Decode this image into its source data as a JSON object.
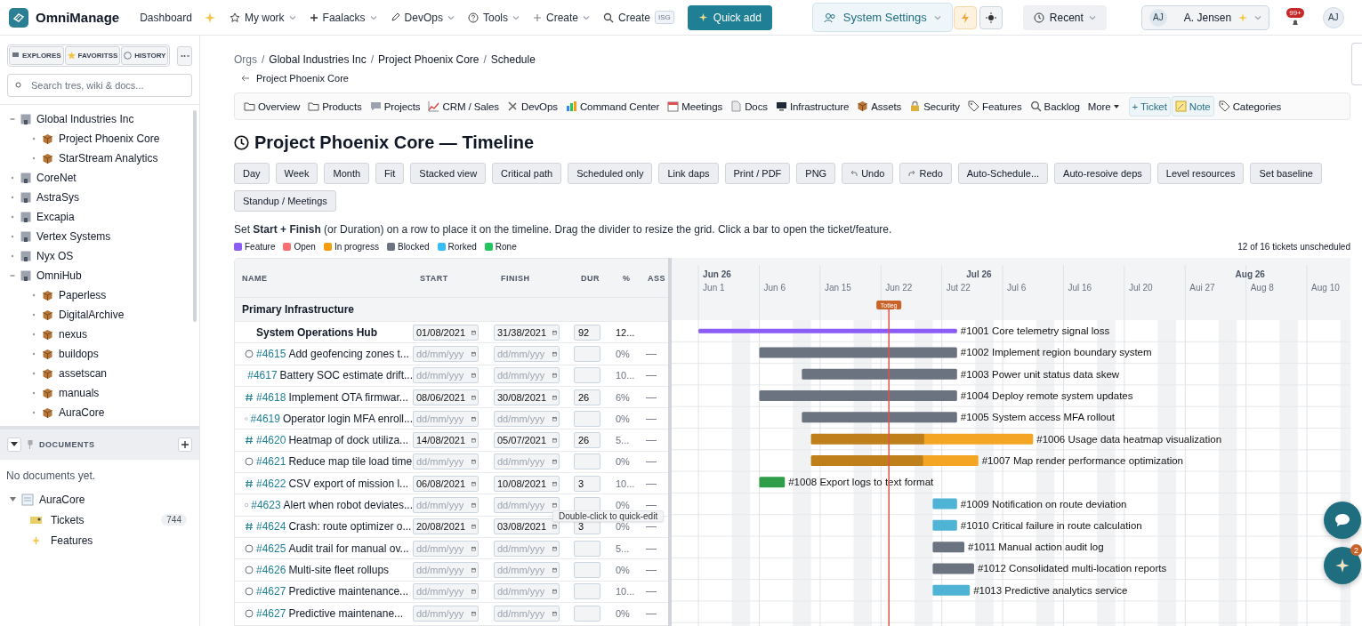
{
  "topbar": {
    "brand": "OmniManage",
    "nav": [
      {
        "label": "Dashboard",
        "kind": "dashboard",
        "caret": false
      },
      {
        "label": "My work",
        "kind": "star",
        "caret": true
      },
      {
        "label": "Faalacks",
        "kind": "plus",
        "caret": true
      },
      {
        "label": "DevOps",
        "kind": "pencil",
        "caret": true
      },
      {
        "label": "Tools",
        "kind": "help",
        "caret": true
      },
      {
        "label": "Create",
        "kind": "plus-light",
        "caret": true
      },
      {
        "label": "Create",
        "kind": "search",
        "caret": false,
        "shortcut": "ISG"
      }
    ],
    "quick_add": "Quick add",
    "settings": "System Settings",
    "recent": "Recent",
    "user": {
      "initials": "AJ",
      "name": "A. Jensen"
    },
    "notifications": "99+",
    "avatar": "AJ"
  },
  "sidebar": {
    "tabs": [
      "EXPLORES",
      "FAVORITSS",
      "HISTORY"
    ],
    "search": {
      "placeholder": "Search tres, wiki & docs..."
    },
    "tree": [
      {
        "label": "Global Industries Inc",
        "expanded": true,
        "children": [
          {
            "label": "Project Phoenix Core"
          },
          {
            "label": "StarStream Analytics"
          }
        ]
      },
      {
        "label": "CoreNet",
        "expanded": false
      },
      {
        "label": "AstraSys",
        "expanded": false
      },
      {
        "label": "Excapia",
        "expanded": false
      },
      {
        "label": "Vertex Systems",
        "expanded": false
      },
      {
        "label": "Nyx OS",
        "expanded": false
      },
      {
        "label": "OmniHub",
        "expanded": true,
        "children": [
          {
            "label": "Paperless"
          },
          {
            "label": "DigitalArchive"
          },
          {
            "label": "nexus"
          },
          {
            "label": "buildops"
          },
          {
            "label": "assetscan"
          },
          {
            "label": "manuals"
          },
          {
            "label": "AuraCore"
          }
        ]
      }
    ],
    "documents": {
      "title": "DOCUMENTS",
      "empty": "No documents yet.",
      "tree": {
        "label": "AuraCore",
        "expanded": true,
        "children": [
          {
            "label": "Tickets",
            "kind": "tickets",
            "count": "744"
          },
          {
            "label": "Features",
            "kind": "features"
          }
        ]
      }
    }
  },
  "breadcrumb": [
    {
      "label": "Orgs"
    },
    {
      "separator": "/",
      "label": "Global Industries Inc"
    },
    {
      "separator": "/",
      "label": "Project Phoenix Core"
    },
    {
      "separator": "/",
      "label": "Schedule"
    }
  ],
  "back_link": "Project Phoenix Core",
  "tabs": [
    {
      "label": "Overview",
      "kind": "tab"
    },
    {
      "label": "Products",
      "kind": "tab"
    },
    {
      "label": "Projects",
      "kind": "tab"
    },
    {
      "label": "CRM / Sales",
      "kind": "tab"
    },
    {
      "label": "DevOps",
      "kind": "tab"
    },
    {
      "label": "Command Center",
      "kind": "tab"
    },
    {
      "label": "Meetings",
      "kind": "tab"
    },
    {
      "label": "Docs",
      "kind": "tab"
    },
    {
      "label": "Infrastructure",
      "kind": "tab"
    },
    {
      "label": "Assets",
      "kind": "tab"
    },
    {
      "label": "Security",
      "kind": "tab"
    },
    {
      "label": "Features",
      "kind": "tab"
    },
    {
      "label": "Backlog",
      "kind": "tab"
    },
    {
      "label": "More",
      "kind": "menu"
    },
    {
      "label": "+ Ticket",
      "kind": "action"
    },
    {
      "label": "Note",
      "kind": "action"
    },
    {
      "label": "Categories",
      "kind": "tab"
    }
  ],
  "title": "Project Phoenix Core — Timeline",
  "toolbar": [
    {
      "label": "Day",
      "kind": "plain"
    },
    {
      "label": "Week",
      "kind": "plain"
    },
    {
      "label": "Month",
      "kind": "plain"
    },
    {
      "label": "Fit",
      "kind": "plain"
    },
    {
      "label": "Stacked view",
      "kind": "plain"
    },
    {
      "label": "Critical path",
      "kind": "plain"
    },
    {
      "label": "Scheduled only",
      "kind": "plain"
    },
    {
      "label": "Link daps",
      "kind": "plain"
    },
    {
      "label": "Print / PDF",
      "kind": "plain"
    },
    {
      "label": "PNG",
      "kind": "plain"
    },
    {
      "label": "Undo",
      "kind": "undo"
    },
    {
      "label": "Redo",
      "kind": "redo"
    },
    {
      "label": "Auto-Schedule...",
      "kind": "plain"
    },
    {
      "label": "Auto-resoive deps",
      "kind": "plain"
    },
    {
      "label": "Level resources",
      "kind": "plain"
    },
    {
      "label": "Set baseline",
      "kind": "plain"
    },
    {
      "label": "Standup / Meetings",
      "kind": "plain"
    }
  ],
  "hint": "Set **Start + Finish** (or Duration) on a row to place it on the timeline. Drag the divider to resize the grid. Click a bar to open the ticket/feature.",
  "legend": [
    {
      "label": "Feature",
      "color": "#8b5cf6"
    },
    {
      "label": "Open",
      "color": "#f87171"
    },
    {
      "label": "In progress",
      "color": "#f59e0b"
    },
    {
      "label": "Blocked",
      "color": "#6b7280"
    },
    {
      "label": "Rorked",
      "color": "#38bdf8"
    },
    {
      "label": "Rone",
      "color": "#22c55e"
    }
  ],
  "unscheduled": "12 of 16 tickets unscheduled",
  "table": {
    "columns": [
      "NAME",
      "START",
      "FINISH",
      "DUR",
      "%",
      "ASS"
    ],
    "group": "Primary Infrastructure",
    "rows": [
      {
        "kind": "parent",
        "title": "System Operations Hub",
        "start": "01/08/2021",
        "finish": "31/38/2021",
        "dur": "92",
        "pct": "12..."
      },
      {
        "kind": "open",
        "id": "#4615",
        "title": "Add geofencing zones t...",
        "start_placeholder": "dd/mm/yyy",
        "finish_placeholder": "dd/mm/yyy",
        "pct": "0%",
        "assignee": "—"
      },
      {
        "kind": "open",
        "id": "#4617",
        "title": "Battery SOC estimate drift...",
        "start_placeholder": "dd/mm/yyy",
        "finish_placeholder": "dd/mm/yyy",
        "pct": "10...",
        "assignee": "—"
      },
      {
        "kind": "feature",
        "id": "#4618",
        "title": "Implement OTA firmwar...",
        "start": "08/06/2021",
        "finish": "30/08/2021",
        "dur": "26",
        "pct": "6%",
        "assignee": "—"
      },
      {
        "kind": "open",
        "id": "#4619",
        "title": "Operator login MFA enroll...",
        "start_placeholder": "dd/mm/yyy",
        "finish_placeholder": "dd/mm/yyy",
        "pct": "0%",
        "assignee": "—"
      },
      {
        "kind": "feature",
        "id": "#4620",
        "title": "Heatmap of dock utiliza...",
        "start": "14/08/2021",
        "finish": "05/07/2021",
        "dur": "26",
        "pct": "5...",
        "assignee": "—"
      },
      {
        "kind": "open",
        "id": "#4621",
        "title": "Reduce map tile load time",
        "start_placeholder": "dd/mm/yyy",
        "finish_placeholder": "dd/mm/yyy",
        "pct": "0%",
        "assignee": "—"
      },
      {
        "kind": "feature",
        "id": "#4622",
        "title": "CSV export of mission l...",
        "start": "06/08/2021",
        "finish": "10/08/2021",
        "dur": "3",
        "pct": "10...",
        "assignee": "—"
      },
      {
        "kind": "open",
        "id": "#4623",
        "title": "Alert when robot deviates...",
        "start_placeholder": "dd/mm/yyy",
        "finish_placeholder": "dd/mm/yyy",
        "pct": "0%",
        "assignee": "—"
      },
      {
        "kind": "feature",
        "id": "#4624",
        "title": "Crash: route optimizer o...",
        "start": "20/08/2021",
        "finish": "03/08/2021",
        "dur": "3",
        "pct": "0%",
        "assignee": "—"
      },
      {
        "kind": "open",
        "id": "#4625",
        "title": "Audit trail for manual ov...",
        "start_placeholder": "dd/mm/yyy",
        "finish_placeholder": "dd/mm/yyy",
        "pct": "5...",
        "assignee": "—"
      },
      {
        "kind": "open",
        "id": "#4626",
        "title": "Multi-site fleet rollups",
        "start_placeholder": "dd/mm/yyy",
        "finish_placeholder": "dd/mm/yyy",
        "pct": "0%",
        "assignee": "—"
      },
      {
        "kind": "open",
        "id": "#4627",
        "title": "Predictive maintenance...",
        "start_placeholder": "dd/mm/yyy",
        "finish_placeholder": "dd/mm/yyy",
        "pct": "10...",
        "assignee": "—"
      },
      {
        "kind": "open",
        "id": "#4627",
        "title": "Predictive maintenane...",
        "start_placeholder": "dd/mm/yyy",
        "finish_placeholder": "dd/mm/yyy",
        "pct": "0%",
        "assignee": "—"
      }
    ],
    "tooltip": "Double-click to quick-edit"
  },
  "gantt": {
    "months": [
      "Jun 26",
      "Jul 26",
      "Aug 26"
    ],
    "dates": [
      "Jun 1",
      "Jun 6",
      "Jan 15",
      "Jun 22",
      "Jut 22",
      "Jul 6",
      "Jul 16",
      "Jul 20",
      "Aui 27",
      "Aug 8",
      "Aug 10"
    ],
    "today": "Totleg",
    "bars": [
      {
        "label": "#1001 Core telemetry signal loss",
        "kind": "summary",
        "color": "#8b5cf6"
      },
      {
        "label": "#1002 Implement region boundary system",
        "kind": "task",
        "color": "#6b7280"
      },
      {
        "label": "#1003 Power unit status data skew",
        "kind": "task",
        "color": "#6b7280"
      },
      {
        "label": "#1004 Deploy remote system updates",
        "kind": "task",
        "color": "#6b7280"
      },
      {
        "label": "#1005 System access MFA rollout",
        "kind": "task",
        "color": "#6b7280"
      },
      {
        "label": "#1006 Usage data heatmap visualization",
        "kind": "task",
        "color": "#f5a524",
        "level": 0.51
      },
      {
        "label": "#1007 Map render performance optimization",
        "kind": "task",
        "color": "#f5a524",
        "level": 0.67
      },
      {
        "label": "#1008 Export logs to text format",
        "kind": "task",
        "color": "#2e9e4a"
      },
      {
        "label": "#1009 Notification on route deviation",
        "kind": "task",
        "color": "#4fb3d6"
      },
      {
        "label": "#1010 Critical failure in route calculation",
        "kind": "task",
        "color": "#4fb3d6"
      },
      {
        "label": "#1011 Manual action audit log",
        "kind": "task",
        "color": "#6b7280"
      },
      {
        "label": "#1012 Consolidated multi-location reports",
        "kind": "task",
        "color": "#6b7280"
      },
      {
        "label": "#1013 Predictive analytics service",
        "kind": "task",
        "color": "#4fb3d6"
      }
    ]
  },
  "fab_badge": "2"
}
